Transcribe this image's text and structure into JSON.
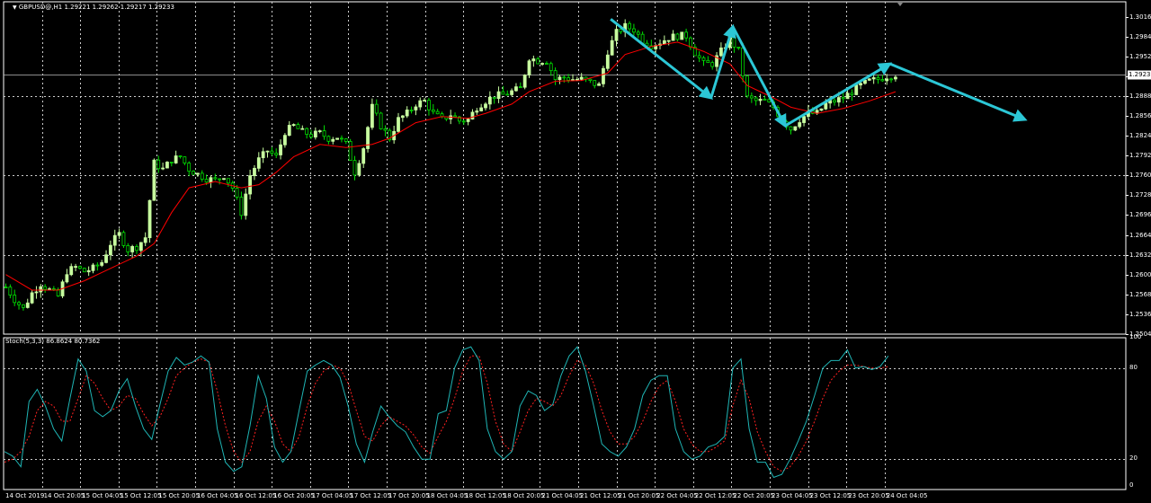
{
  "main_header": {
    "symbol": "GBPUSD@,H1",
    "ohlc": "1.29221 1.29262 1.29217 1.29233"
  },
  "sub_header": {
    "indicator": "Stoch(5,3,3)",
    "values": "86.8624 80.7362"
  },
  "colors": {
    "background": "#000000",
    "bull": "#c8ffa0",
    "bear": "#00e000",
    "ma": "#ff0000",
    "stoch_main": "#1fb5b5",
    "stoch_signal": "#ff2020",
    "arrows": "#2cc7d6",
    "grid": "#cccccc",
    "price_line": "#bbbbbb"
  },
  "chart_data": [
    {
      "type": "candlestick",
      "title": "GBPUSD@,H1",
      "bid_label": "1.29233",
      "price_ticks": [
        "1.30160",
        "1.29840",
        "1.29520",
        "1.29200",
        "1.28880",
        "1.28560",
        "1.28240",
        "1.27920",
        "1.27600",
        "1.27280",
        "1.26960",
        "1.26640",
        "1.26320",
        "1.26000",
        "1.25680",
        "1.25360",
        "1.25040"
      ],
      "ylim": [
        1.2504,
        1.304
      ],
      "time_ticks": [
        "14 Oct 2019",
        "14 Oct 20:05",
        "15 Oct 04:05",
        "15 Oct 12:05",
        "15 Oct 20:05",
        "16 Oct 04:05",
        "16 Oct 12:05",
        "16 Oct 20:05",
        "17 Oct 04:05",
        "17 Oct 12:05",
        "17 Oct 20:05",
        "18 Oct 04:05",
        "18 Oct 12:05",
        "18 Oct 20:05",
        "21 Oct 04:05",
        "21 Oct 12:05",
        "21 Oct 20:05",
        "22 Oct 04:05",
        "22 Oct 12:05",
        "22 Oct 20:05",
        "23 Oct 04:05",
        "23 Oct 12:05",
        "23 Oct 20:05",
        "24 Oct 04:05"
      ],
      "close_path": [
        [
          0,
          1.258
        ],
        [
          2,
          1.256
        ],
        [
          4,
          1.2545
        ],
        [
          6,
          1.257
        ],
        [
          8,
          1.2585
        ],
        [
          10,
          1.2575
        ],
        [
          12,
          1.2565
        ],
        [
          14,
          1.2605
        ],
        [
          16,
          1.2612
        ],
        [
          18,
          1.2605
        ],
        [
          20,
          1.261
        ],
        [
          22,
          1.262
        ],
        [
          24,
          1.265
        ],
        [
          26,
          1.2665
        ],
        [
          28,
          1.264
        ],
        [
          30,
          1.2645
        ],
        [
          32,
          1.266
        ],
        [
          34,
          1.278
        ],
        [
          36,
          1.277
        ],
        [
          38,
          1.2785
        ],
        [
          40,
          1.279
        ],
        [
          42,
          1.277
        ],
        [
          44,
          1.2762
        ],
        [
          46,
          1.2755
        ],
        [
          48,
          1.2752
        ],
        [
          50,
          1.276
        ],
        [
          52,
          1.274
        ],
        [
          54,
          1.27
        ],
        [
          56,
          1.276
        ],
        [
          58,
          1.2785
        ],
        [
          60,
          1.28
        ],
        [
          62,
          1.279
        ],
        [
          64,
          1.283
        ],
        [
          66,
          1.284
        ],
        [
          68,
          1.283
        ],
        [
          70,
          1.2825
        ],
        [
          72,
          1.2828
        ],
        [
          74,
          1.282
        ],
        [
          76,
          1.2822
        ],
        [
          78,
          1.281
        ],
        [
          80,
          1.2765
        ],
        [
          82,
          1.2805
        ],
        [
          84,
          1.287
        ],
        [
          86,
          1.284
        ],
        [
          88,
          1.282
        ],
        [
          90,
          1.285
        ],
        [
          92,
          1.286
        ],
        [
          94,
          1.2875
        ],
        [
          96,
          1.288
        ],
        [
          98,
          1.286
        ],
        [
          100,
          1.285
        ],
        [
          102,
          1.2858
        ],
        [
          104,
          1.2848
        ],
        [
          106,
          1.285
        ],
        [
          108,
          1.287
        ],
        [
          110,
          1.288
        ],
        [
          112,
          1.2888
        ],
        [
          114,
          1.289
        ],
        [
          116,
          1.2895
        ],
        [
          118,
          1.29
        ],
        [
          120,
          1.295
        ],
        [
          122,
          1.2945
        ],
        [
          124,
          1.2945
        ],
        [
          126,
          1.2915
        ],
        [
          128,
          1.2918
        ],
        [
          130,
          1.2915
        ],
        [
          132,
          1.2915
        ],
        [
          134,
          1.291
        ],
        [
          136,
          1.2905
        ],
        [
          138,
          1.296
        ],
        [
          140,
          1.299
        ],
        [
          142,
          1.3
        ],
        [
          144,
          1.2995
        ],
        [
          146,
          1.2978
        ],
        [
          148,
          1.297
        ],
        [
          150,
          1.2975
        ],
        [
          152,
          1.2982
        ],
        [
          154,
          1.2985
        ],
        [
          156,
          1.2985
        ],
        [
          158,
          1.2958
        ],
        [
          160,
          1.294
        ],
        [
          162,
          1.294
        ],
        [
          164,
          1.296
        ],
        [
          166,
          1.298
        ],
        [
          168,
          1.296
        ],
        [
          170,
          1.2885
        ],
        [
          172,
          1.288
        ],
        [
          174,
          1.288
        ],
        [
          176,
          1.287
        ],
        [
          178,
          1.285
        ],
        [
          180,
          1.2835
        ],
        [
          182,
          1.285
        ],
        [
          184,
          1.286
        ],
        [
          186,
          1.286
        ],
        [
          188,
          1.2875
        ],
        [
          190,
          1.288
        ],
        [
          192,
          1.2885
        ],
        [
          194,
          1.2895
        ],
        [
          196,
          1.2905
        ],
        [
          198,
          1.2912
        ],
        [
          200,
          1.2915
        ],
        [
          202,
          1.292
        ],
        [
          204,
          1.2923
        ]
      ],
      "ma_path": [
        [
          0,
          1.26
        ],
        [
          6,
          1.2575
        ],
        [
          12,
          1.2575
        ],
        [
          18,
          1.259
        ],
        [
          24,
          1.261
        ],
        [
          30,
          1.263
        ],
        [
          34,
          1.265
        ],
        [
          38,
          1.27
        ],
        [
          42,
          1.274
        ],
        [
          48,
          1.275
        ],
        [
          54,
          1.274
        ],
        [
          58,
          1.2745
        ],
        [
          62,
          1.2765
        ],
        [
          66,
          1.279
        ],
        [
          72,
          1.281
        ],
        [
          78,
          1.2805
        ],
        [
          84,
          1.281
        ],
        [
          88,
          1.282
        ],
        [
          94,
          1.2845
        ],
        [
          100,
          1.2855
        ],
        [
          106,
          1.2852
        ],
        [
          110,
          1.286
        ],
        [
          116,
          1.2875
        ],
        [
          120,
          1.2895
        ],
        [
          126,
          1.2912
        ],
        [
          132,
          1.2913
        ],
        [
          138,
          1.2925
        ],
        [
          142,
          1.2955
        ],
        [
          148,
          1.2968
        ],
        [
          154,
          1.2975
        ],
        [
          160,
          1.296
        ],
        [
          166,
          1.294
        ],
        [
          170,
          1.2905
        ],
        [
          176,
          1.2885
        ],
        [
          180,
          1.287
        ],
        [
          186,
          1.286
        ],
        [
          192,
          1.2868
        ],
        [
          198,
          1.288
        ],
        [
          204,
          1.2895
        ]
      ],
      "arrows": [
        {
          "from": [
            139,
            1.3012
          ],
          "to": [
            162,
            1.2885
          ]
        },
        {
          "from": [
            162,
            1.2885
          ],
          "to": [
            167,
            1.3
          ]
        },
        {
          "from": [
            167,
            1.3
          ],
          "to": [
            179,
            1.284
          ]
        },
        {
          "from": [
            179,
            1.284
          ],
          "to": [
            203,
            1.294
          ]
        },
        {
          "from": [
            203,
            1.294
          ],
          "to": [
            234,
            1.285
          ]
        }
      ]
    },
    {
      "type": "line",
      "title": "Stoch(5,3,3)",
      "ylim": [
        0,
        100
      ],
      "y_ticks": [
        "100",
        "80",
        "20",
        "0"
      ],
      "levels": [
        80,
        20
      ],
      "series": [
        {
          "values": [
            25,
            22,
            15,
            58,
            66,
            55,
            40,
            32,
            60,
            86,
            78,
            52,
            48,
            52,
            65,
            73,
            55,
            40,
            33,
            56,
            78,
            87,
            82,
            84,
            88,
            84,
            40,
            18,
            12,
            15,
            42,
            75,
            60,
            28,
            18,
            25,
            52,
            78,
            82,
            85,
            82,
            74,
            55,
            30,
            18,
            38,
            55,
            48,
            42,
            38,
            28,
            20,
            20,
            50,
            52,
            80,
            92,
            94,
            85,
            40,
            25,
            20,
            25,
            55,
            65,
            62,
            52,
            56,
            75,
            88,
            94,
            78,
            55,
            30,
            25,
            22,
            28,
            40,
            62,
            72,
            75,
            75,
            40,
            25,
            20,
            22,
            28,
            30,
            35,
            80,
            86,
            40,
            18,
            18,
            8,
            10,
            20,
            32,
            45,
            62,
            80,
            85,
            85,
            92,
            80,
            81,
            79,
            81,
            88
          ]
        },
        {
          "values": [
            18,
            20,
            25,
            35,
            52,
            58,
            55,
            45,
            45,
            60,
            75,
            70,
            60,
            52,
            55,
            62,
            60,
            50,
            42,
            48,
            60,
            75,
            80,
            84,
            86,
            84,
            65,
            42,
            25,
            18,
            25,
            45,
            55,
            45,
            30,
            25,
            35,
            55,
            70,
            78,
            82,
            80,
            70,
            52,
            35,
            32,
            42,
            48,
            45,
            42,
            36,
            28,
            24,
            35,
            45,
            60,
            78,
            88,
            88,
            70,
            45,
            30,
            25,
            38,
            52,
            60,
            58,
            55,
            62,
            75,
            85,
            82,
            70,
            52,
            38,
            30,
            30,
            35,
            45,
            58,
            68,
            72,
            58,
            40,
            30,
            25,
            25,
            28,
            32,
            55,
            72,
            60,
            38,
            25,
            15,
            12,
            15,
            22,
            32,
            45,
            60,
            72,
            78,
            82,
            82,
            81,
            80,
            80,
            81
          ]
        }
      ]
    }
  ]
}
